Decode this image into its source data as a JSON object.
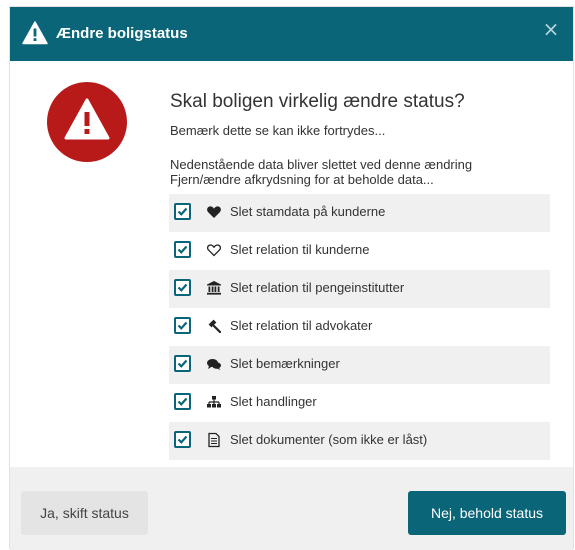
{
  "dialog": {
    "title": "Ændre boligstatus",
    "close_label": "×",
    "heading": "Skal boligen virkelig ændre status?",
    "subheading": "Bemærk dette se kan ikke fortrydes...",
    "info_line1": "Nedenstående data bliver slettet ved denne ændring",
    "info_line2": "Fjern/ændre afkrydsning for at beholde data...",
    "items": [
      {
        "label": "Slet stamdata på kunderne",
        "icon": "heart-solid-icon",
        "checked": true
      },
      {
        "label": "Slet relation til kunderne",
        "icon": "heart-outline-icon",
        "checked": true
      },
      {
        "label": "Slet relation til pengeinstitutter",
        "icon": "bank-icon",
        "checked": true
      },
      {
        "label": "Slet relation til advokater",
        "icon": "gavel-icon",
        "checked": true
      },
      {
        "label": "Slet bemærkninger",
        "icon": "comments-icon",
        "checked": true
      },
      {
        "label": "Slet handlinger",
        "icon": "sitemap-icon",
        "checked": true
      },
      {
        "label": "Slet dokumenter (som ikke er låst)",
        "icon": "document-icon",
        "checked": true
      }
    ],
    "buttons": {
      "confirm": "Ja, skift status",
      "cancel": "Nej, behold status"
    },
    "colors": {
      "header": "#0a6578",
      "warning": "#b81a1a",
      "primary_button": "#0a6578"
    }
  }
}
